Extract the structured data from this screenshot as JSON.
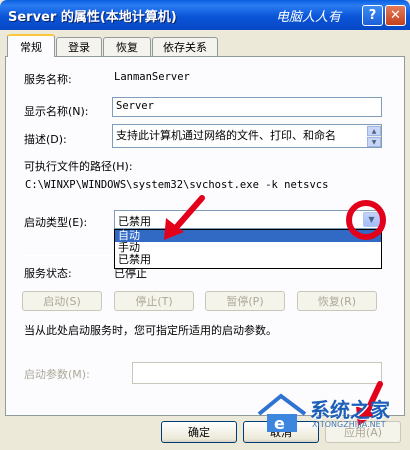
{
  "window": {
    "title": "Server 的属性(本地计算机)",
    "watermark": "电脑人人有",
    "help_label": "?",
    "close_label": "✕"
  },
  "tabs": [
    {
      "label": "常规"
    },
    {
      "label": "登录"
    },
    {
      "label": "恢复"
    },
    {
      "label": "依存关系"
    }
  ],
  "general": {
    "service_name_label": "服务名称:",
    "service_name_value": "LanmanServer",
    "display_name_label": "显示名称(N):",
    "display_name_value": "Server",
    "description_label": "描述(D):",
    "description_value": "支持此计算机通过网络的文件、打印、和命名",
    "exe_path_label": "可执行文件的路径(H):",
    "exe_path_value": "C:\\WINXP\\WINDOWS\\system32\\svchost.exe -k netsvcs",
    "startup_type_label": "启动类型(E):",
    "startup_type_value": "已禁用",
    "startup_options": [
      "自动",
      "手动",
      "已禁用"
    ],
    "service_status_label": "服务状态:",
    "service_status_value": "已停止",
    "start_button": "启动(S)",
    "stop_button": "停止(T)",
    "pause_button": "暂停(P)",
    "resume_button": "恢复(R)",
    "hint_text": "当从此处启动服务时，您可指定所适用的启动参数。",
    "start_params_label": "启动参数(M):",
    "start_params_value": ""
  },
  "footer": {
    "ok_button": "确定",
    "cancel_button": "取消",
    "apply_button": "应用(A)"
  },
  "brand": {
    "logo_text": "系统之家",
    "logo_sub": "XITONGZHIJIA.NET"
  },
  "colors": {
    "annotation_red": "#e3001b",
    "selection_blue": "#316ac5"
  }
}
